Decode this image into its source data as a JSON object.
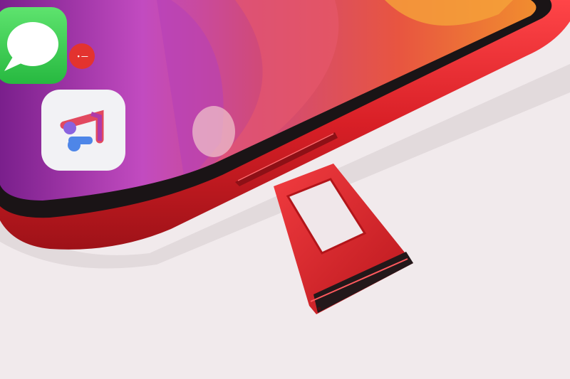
{
  "scene": {
    "background_color": "#f1eaec",
    "phone_color": "#d81f26",
    "tray_color": "#d8232a"
  },
  "home_screen": {
    "apps": [
      {
        "icon": "messages-icon",
        "color": "#35c759",
        "notification_badge": "• —"
      },
      {
        "icon": "music-icon",
        "color": "#f2f2f5"
      }
    ]
  }
}
